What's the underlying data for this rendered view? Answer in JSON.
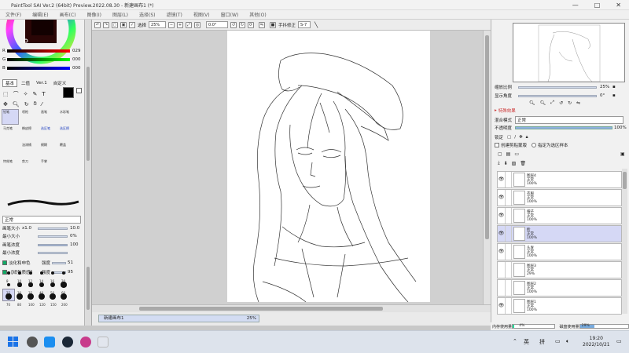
{
  "window": {
    "title": "PaintTool SAI Ver.2 (64bit) Preview.2022.08.30 - 新建画布1 (*)",
    "controls": [
      "—",
      "□",
      "✕"
    ]
  },
  "menubar": [
    "文件(F)",
    "编辑(E)",
    "画布(C)",
    "图像(I)",
    "图层(L)",
    "选择(S)",
    "滤镜(T)",
    "视图(V)",
    "窗口(W)",
    "其他(O)"
  ],
  "toolbar": {
    "select_label": "选择",
    "zoom": "25%",
    "rotation": "0.0°",
    "stabilizer_label": "手抖修正",
    "stabilizer": "S-7"
  },
  "left_panel": {
    "color_values": {
      "r": "029",
      "g": "000",
      "b": "000"
    },
    "tabs": [
      "基本",
      "二值",
      "Ver.1",
      "自定义"
    ],
    "tool_names": [
      "铅笔",
      "喷枪",
      "画笔",
      "水彩笔",
      "马克笔",
      "橡皮擦",
      "选区笔",
      "选区擦",
      "油漆桶",
      "模糊",
      "覆盖",
      "钢笔",
      "特效笔",
      "剪刀",
      "手掌"
    ],
    "blend_mode": "正常",
    "brush_size_label": "画笔大小",
    "brush_size_mult": "x1.0",
    "brush_size": "10.0",
    "min_size_label": "最小大小",
    "min_size": "0%",
    "density_label": "画笔浓度",
    "density": "100",
    "min_density_label": "最小浓度",
    "blend_label": "淡化和申色",
    "blend_val": "强度",
    "blend_num": "51",
    "texture_label": "【纸张质感】",
    "texture_val": "强度",
    "texture_num": "95",
    "brush_sizes": [
      "8",
      "10",
      "12",
      "14",
      "16",
      "20",
      "25",
      "30",
      "35",
      "40",
      "50",
      "60",
      "70",
      "80",
      "100",
      "120",
      "150",
      "200"
    ]
  },
  "document": {
    "tab_name": "新建画布1",
    "tab_zoom": "25%"
  },
  "right_panel": {
    "zoom_label": "缩放比例",
    "zoom_val": "25%",
    "angle_label": "显示角度",
    "angle_val": "0°",
    "effects_label": "特殊效果",
    "blend_mode_label": "混合模式",
    "blend_mode_val": "正常",
    "opacity_label": "不透明度",
    "opacity_val": "100%",
    "lock_label": "锁定",
    "clip_label": "创建剪贴蒙版",
    "selection_label": "指定为选区样本",
    "layers": [
      {
        "name": "图层4",
        "mode": "正常",
        "opacity": "100%",
        "visible": true
      },
      {
        "name": "衣服",
        "mode": "正常",
        "opacity": "100%",
        "visible": true
      },
      {
        "name": "帽子",
        "mode": "正常",
        "opacity": "100%",
        "visible": true
      },
      {
        "name": "脸",
        "mode": "正常",
        "opacity": "100%",
        "visible": true,
        "selected": true
      },
      {
        "name": "头发",
        "mode": "正常",
        "opacity": "100%",
        "visible": true
      },
      {
        "name": "图层3",
        "mode": "正常",
        "opacity": "29%",
        "visible": false
      },
      {
        "name": "图层2",
        "mode": "正常",
        "opacity": "100%",
        "visible": false
      },
      {
        "name": "图层1",
        "mode": "正常",
        "opacity": "100%",
        "visible": true
      }
    ]
  },
  "status": {
    "memory_label": "内存使用量",
    "memory_val": "4%",
    "disk_label": "磁盘使用量",
    "disk_val": "29%"
  },
  "taskbar": {
    "ime_lang": "英",
    "ime_mode": "拼",
    "time": "19:20",
    "date": "2022/10/21"
  }
}
